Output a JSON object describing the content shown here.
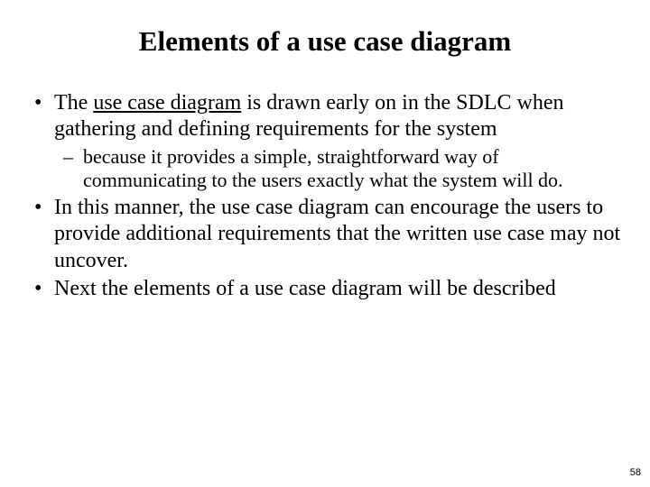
{
  "title": "Elements of a use case diagram",
  "bullets": {
    "b1_pre": "The ",
    "b1_underlined": "use case diagram",
    "b1_post": " is drawn early on in the SDLC when gathering and defining requirements for the system",
    "b1_sub": "because it provides a simple, straightforward way of communicating to the users exactly what the system will do.",
    "b2": "In this manner, the use case diagram can encourage the users to provide additional requirements that the written use case may not uncover.",
    "b3": "Next the elements of a use case diagram will be described"
  },
  "page_number": "58"
}
